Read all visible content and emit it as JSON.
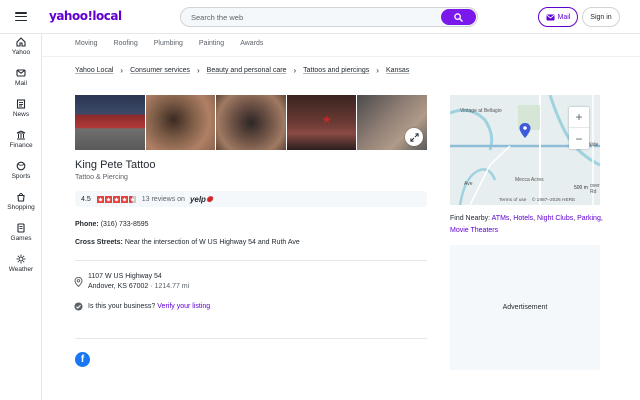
{
  "header": {
    "logo_text": "yahoo!local",
    "search_placeholder": "Search the web",
    "mail_label": "Mail",
    "signin_label": "Sign in"
  },
  "sidebar": {
    "items": [
      {
        "label": "Yahoo",
        "icon": "home-icon"
      },
      {
        "label": "Mail",
        "icon": "mail-icon"
      },
      {
        "label": "News",
        "icon": "news-icon"
      },
      {
        "label": "Finance",
        "icon": "finance-icon"
      },
      {
        "label": "Sports",
        "icon": "sports-icon"
      },
      {
        "label": "Shopping",
        "icon": "shopping-icon"
      },
      {
        "label": "Games",
        "icon": "games-icon"
      },
      {
        "label": "Weather",
        "icon": "weather-icon"
      }
    ]
  },
  "categories": [
    "Moving",
    "Roofing",
    "Plumbing",
    "Painting",
    "Awards"
  ],
  "breadcrumbs": [
    "Yahoo Local",
    "Consumer services",
    "Beauty and personal care",
    "Tattoos and piercings",
    "Kansas"
  ],
  "business": {
    "name": "King Pete Tattoo",
    "category": "Tattoo & Piercing",
    "rating": "4.5",
    "rating_value": 4.5,
    "reviews_text": "13 reviews on",
    "yelp_label": "yelp",
    "phone_label": "Phone:",
    "phone": "(316) 733-8595",
    "cross_label": "Cross Streets:",
    "cross_streets": "Near the intersection of W US Highway 54 and Ruth Ave",
    "address_line1": "1107 W US Highway 54",
    "address_line2": "Andover, KS 67002",
    "distance": "· 1214.77 mi",
    "biz_question": "Is this your business?",
    "verify_label": "Verify your listing"
  },
  "map": {
    "labels": [
      "Vintage at Bellagio",
      "Mecca Acres",
      "Nide",
      "over Rd",
      "Ave"
    ],
    "zoom_in": "+",
    "zoom_out": "−",
    "scale": "500 m",
    "terms": "Terms of use",
    "copyright": "© 1987–2026 HERE"
  },
  "nearby": {
    "label": "Find Nearby:",
    "links": [
      "ATMs",
      "Hotels",
      "Night Clubs",
      "Parking",
      "Movie Theaters"
    ]
  },
  "ad_label": "Advertisement",
  "colors": {
    "brand": "#6001d2",
    "search_button": "#7b18eb",
    "yelp_star": "#e0443e",
    "facebook": "#1877f2"
  }
}
